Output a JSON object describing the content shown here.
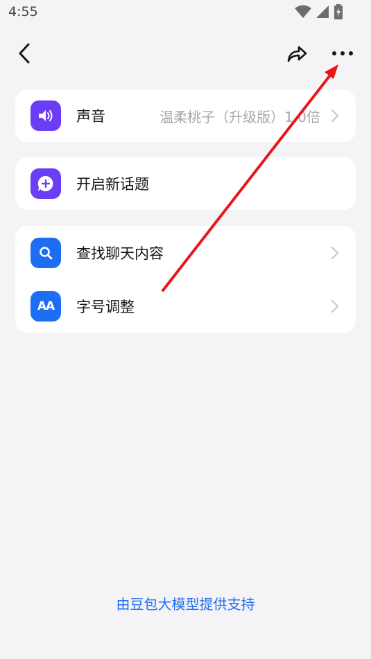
{
  "status_bar": {
    "time": "4:55",
    "icons": [
      "wifi-icon",
      "signal-icon",
      "battery-charging-icon"
    ]
  },
  "top_bar": {
    "icons": [
      "back-icon",
      "share-icon",
      "more-icon"
    ]
  },
  "sections": {
    "voice": {
      "label": "声音",
      "value": "温柔桃子（升级版）1.0倍",
      "icon": "speaker-icon"
    },
    "new_topic": {
      "label": "开启新话题",
      "icon": "chat-plus-icon"
    },
    "search_chat": {
      "label": "查找聊天内容",
      "icon": "search-icon"
    },
    "font_size": {
      "label": "字号调整",
      "icon": "font-size-icon",
      "icon_text": "AA"
    }
  },
  "footer": {
    "text": "由豆包大模型提供支持"
  },
  "colors": {
    "background": "#f4f4f6",
    "card": "#ffffff",
    "purple": "#6b3df5",
    "blue": "#1e6ef5",
    "link": "#1f6ff0",
    "annotation_arrow": "#e8161b"
  }
}
